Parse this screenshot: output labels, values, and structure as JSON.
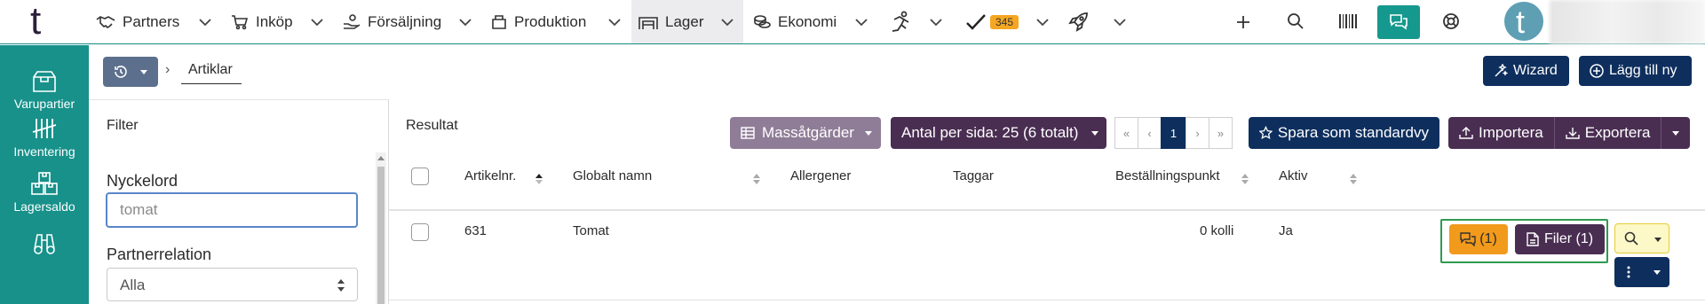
{
  "nav": {
    "logo_letter": "t",
    "items": [
      {
        "label": "Partners",
        "icon": "handshake-icon"
      },
      {
        "label": "Inköp",
        "icon": "cart-icon"
      },
      {
        "label": "Försäljning",
        "icon": "hand-coin-icon"
      },
      {
        "label": "Produktion",
        "icon": "box-open-icon"
      },
      {
        "label": "Lager",
        "icon": "warehouse-icon"
      },
      {
        "label": "Ekonomi",
        "icon": "coins-icon"
      }
    ],
    "tasks_badge": "345",
    "avatar_letter": "t"
  },
  "sidebar": {
    "items": [
      {
        "label": "Varupartier",
        "icon": "box-icon"
      },
      {
        "label": "Inventering",
        "icon": "tally-icon"
      },
      {
        "label": "Lagersaldo",
        "icon": "boxes-icon"
      },
      {
        "label": "",
        "icon": "binoculars-icon"
      }
    ]
  },
  "breadcrumb": {
    "current": "Artiklar"
  },
  "header_buttons": {
    "wizard": "Wizard",
    "add_new": "Lägg till ny"
  },
  "filter": {
    "title": "Filter",
    "keyword_label": "Nyckelord",
    "keyword_value": "",
    "keyword_placeholder": "tomat",
    "partner_label": "Partnerrelation",
    "partner_value": "Alla"
  },
  "results": {
    "title": "Resultat",
    "bulk_actions": "Massåtgärder",
    "per_page": "Antal per sida: 25 (6 totalt)",
    "pager": {
      "first": "«",
      "prev": "‹",
      "current": "1",
      "next": "›",
      "last": "»"
    },
    "save_default": "Spara som standardvy",
    "import": "Importera",
    "export": "Exportera",
    "columns": [
      "Artikelnr.",
      "Globalt namn",
      "Allergener",
      "Taggar",
      "Beställningspunkt",
      "Aktiv"
    ],
    "rows": [
      {
        "artikelnr": "631",
        "namn": "Tomat",
        "allergener": "",
        "taggar": "",
        "bestallningspunkt": "0 kolli",
        "aktiv": "Ja",
        "comments": "(1)",
        "files": "Filer (1)"
      }
    ]
  },
  "colors": {
    "teal": "#17918a",
    "navy": "#0e2f5e",
    "plum": "#4a2e52",
    "orange": "#f29a1b",
    "badge": "#f5a623"
  }
}
